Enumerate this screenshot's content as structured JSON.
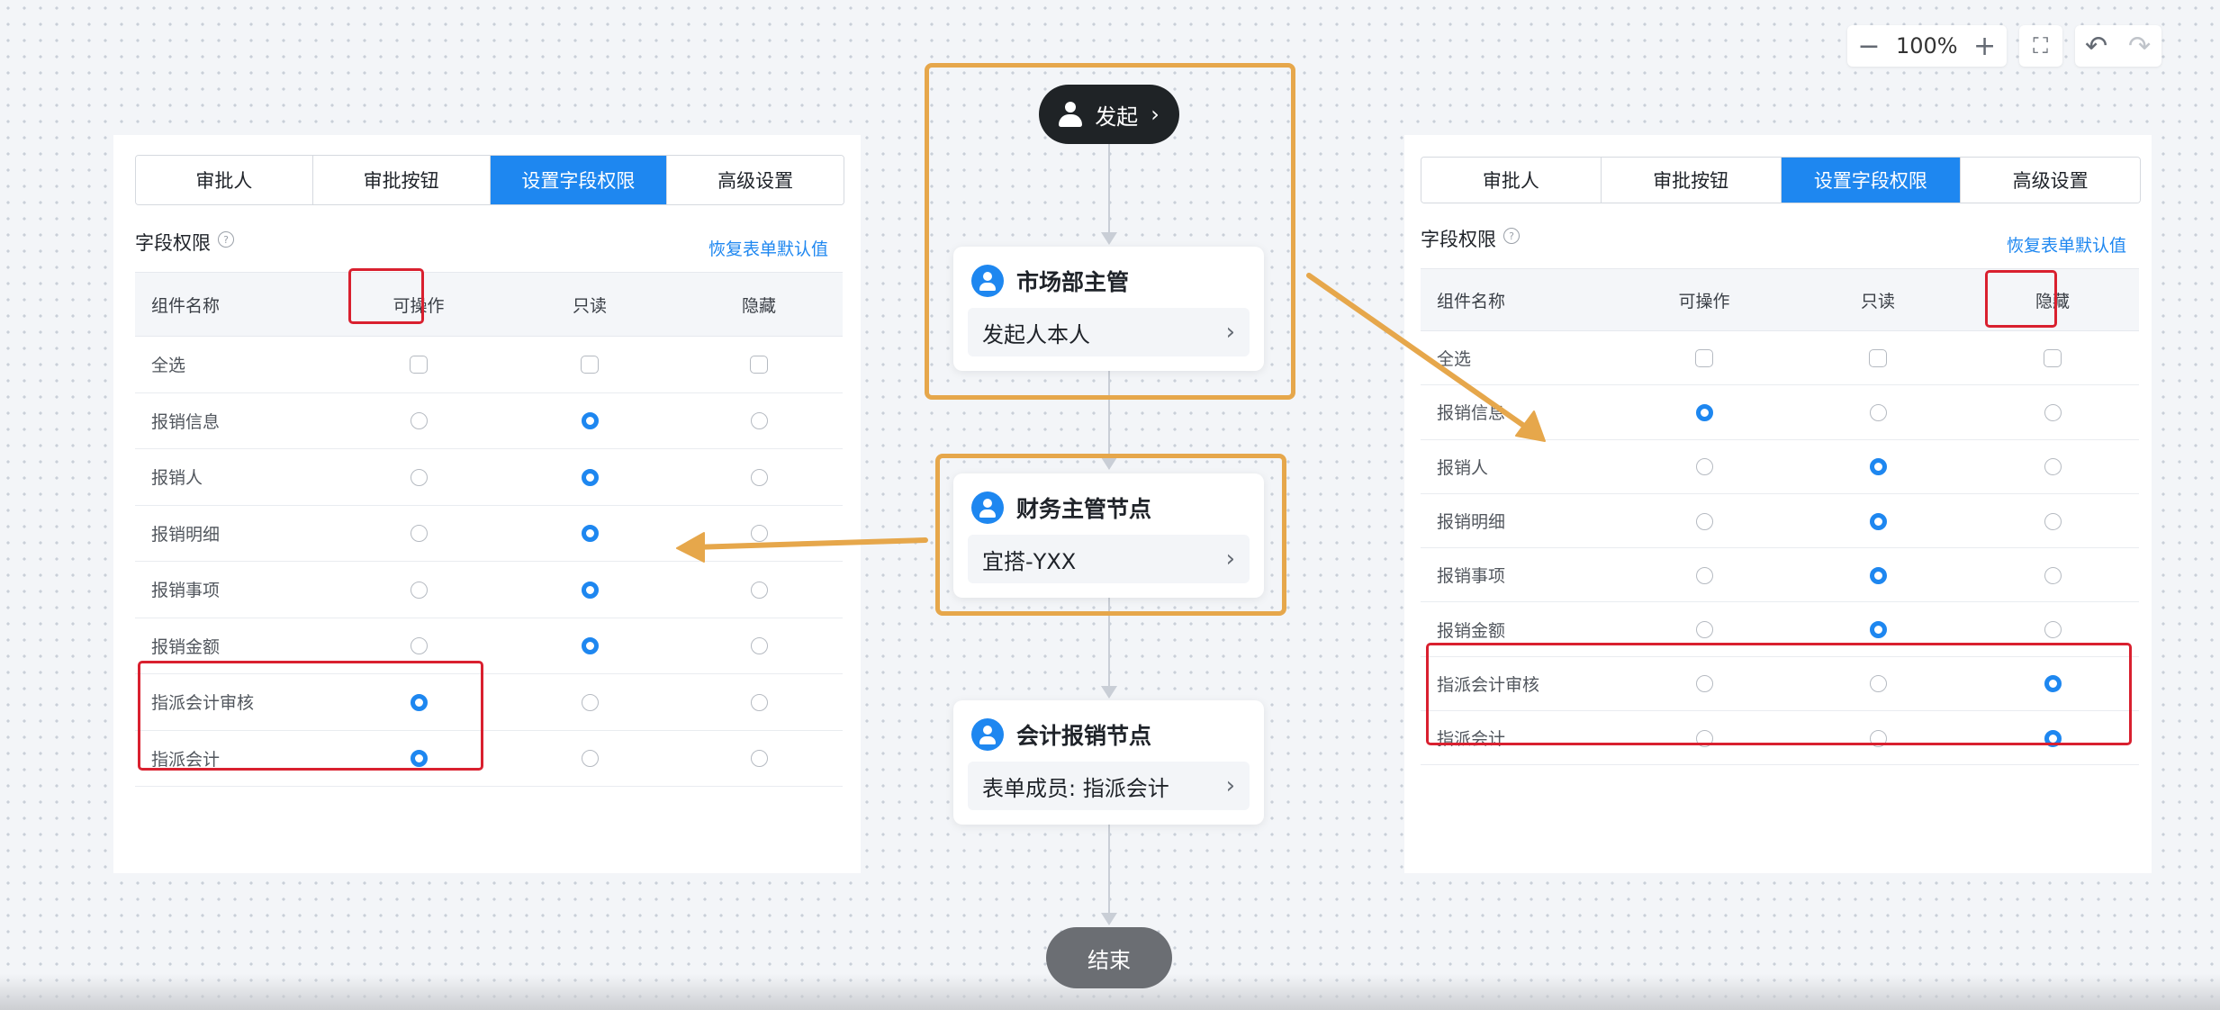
{
  "toolbar": {
    "zoom_out": "−",
    "zoom": "100%",
    "zoom_in": "+",
    "fit": "⛶",
    "undo": "↶",
    "redo": "↷"
  },
  "tabs": [
    "审批人",
    "审批按钮",
    "设置字段权限",
    "高级设置"
  ],
  "active_tab": "设置字段权限",
  "section_title": "字段权限",
  "help": "?",
  "reset_link": "恢复表单默认值",
  "columns": [
    "组件名称",
    "可操作",
    "只读",
    "隐藏"
  ],
  "select_all": "全选",
  "left_panel": {
    "rows": [
      {
        "name": "报销信息",
        "value": "只读"
      },
      {
        "name": "报销人",
        "value": "只读"
      },
      {
        "name": "报销明细",
        "value": "只读"
      },
      {
        "name": "报销事项",
        "value": "只读"
      },
      {
        "name": "报销金额",
        "value": "只读"
      },
      {
        "name": "指派会计审核",
        "value": "可操作"
      },
      {
        "name": "指派会计",
        "value": "可操作"
      }
    ]
  },
  "right_panel": {
    "rows": [
      {
        "name": "报销信息",
        "value": "可操作"
      },
      {
        "name": "报销人",
        "value": "只读"
      },
      {
        "name": "报销明细",
        "value": "只读"
      },
      {
        "name": "报销事项",
        "value": "只读"
      },
      {
        "name": "报销金额",
        "value": "只读"
      },
      {
        "name": "指派会计审核",
        "value": "隐藏"
      },
      {
        "name": "指派会计",
        "value": "隐藏"
      }
    ]
  },
  "flow": {
    "start": "发起",
    "end": "结束",
    "chevron": "›",
    "nodes": [
      {
        "title": "市场部主管",
        "value": "发起人本人"
      },
      {
        "title": "财务主管节点",
        "value": "宜搭-YXX"
      },
      {
        "title": "会计报销节点",
        "value": "表单成员: 指派会计"
      }
    ]
  },
  "colors": {
    "accent": "#1e87f0",
    "highlight_orange": "#e6a74b",
    "highlight_red": "#d9202f"
  }
}
